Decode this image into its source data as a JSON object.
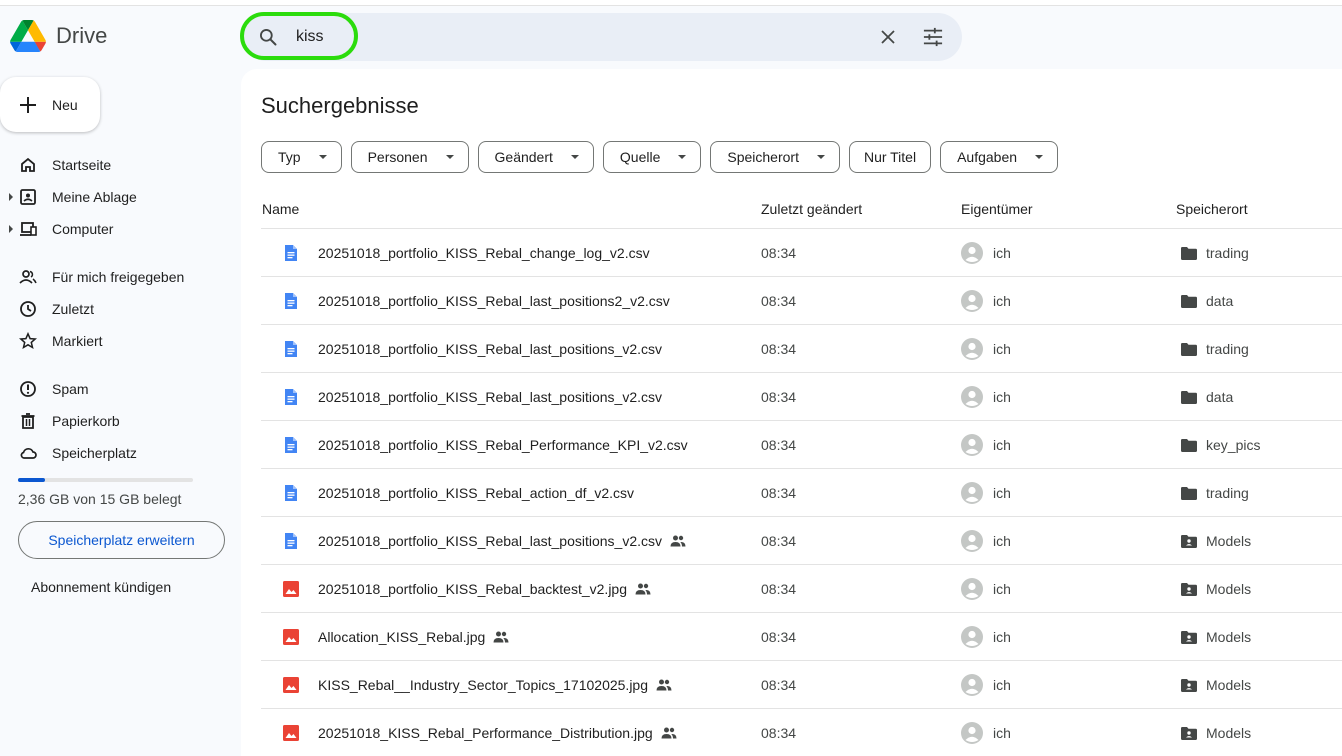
{
  "app": {
    "name": "Drive"
  },
  "search": {
    "value": "kiss"
  },
  "sidebar": {
    "new_label": "Neu",
    "items": [
      {
        "label": "Startseite",
        "icon": "home-icon"
      },
      {
        "label": "Meine Ablage",
        "icon": "my-drive-icon"
      },
      {
        "label": "Computer",
        "icon": "computer-icon"
      },
      {
        "label": "Für mich freigegeben",
        "icon": "shared-icon"
      },
      {
        "label": "Zuletzt",
        "icon": "clock-icon"
      },
      {
        "label": "Markiert",
        "icon": "star-icon"
      },
      {
        "label": "Spam",
        "icon": "spam-icon"
      },
      {
        "label": "Papierkorb",
        "icon": "trash-icon"
      },
      {
        "label": "Speicherplatz",
        "icon": "cloud-icon"
      }
    ],
    "storage_text": "2,36 GB von 15 GB belegt",
    "storage_fraction": 0.157,
    "upgrade_label": "Speicherplatz erweitern",
    "cancel_label": "Abonnement kündigen"
  },
  "main": {
    "title": "Suchergebnisse",
    "filters": [
      "Typ",
      "Personen",
      "Geändert",
      "Quelle",
      "Speicherort",
      "Nur Titel",
      "Aufgaben"
    ],
    "columns": {
      "name": "Name",
      "modified": "Zuletzt geändert",
      "owner": "Eigentümer",
      "location": "Speicherort"
    },
    "rows": [
      {
        "name": "20251018_portfolio_KISS_Rebal_change_log_v2.csv",
        "type": "doc",
        "shared": false,
        "modified": "08:34",
        "owner": "ich",
        "location": "trading",
        "loc_type": "folder"
      },
      {
        "name": "20251018_portfolio_KISS_Rebal_last_positions2_v2.csv",
        "type": "doc",
        "shared": false,
        "modified": "08:34",
        "owner": "ich",
        "location": "data",
        "loc_type": "folder"
      },
      {
        "name": "20251018_portfolio_KISS_Rebal_last_positions_v2.csv",
        "type": "doc",
        "shared": false,
        "modified": "08:34",
        "owner": "ich",
        "location": "trading",
        "loc_type": "folder"
      },
      {
        "name": "20251018_portfolio_KISS_Rebal_last_positions_v2.csv",
        "type": "doc",
        "shared": false,
        "modified": "08:34",
        "owner": "ich",
        "location": "data",
        "loc_type": "folder"
      },
      {
        "name": "20251018_portfolio_KISS_Rebal_Performance_KPI_v2.csv",
        "type": "doc",
        "shared": false,
        "modified": "08:34",
        "owner": "ich",
        "location": "key_pics",
        "loc_type": "folder"
      },
      {
        "name": "20251018_portfolio_KISS_Rebal_action_df_v2.csv",
        "type": "doc",
        "shared": false,
        "modified": "08:34",
        "owner": "ich",
        "location": "trading",
        "loc_type": "folder"
      },
      {
        "name": "20251018_portfolio_KISS_Rebal_last_positions_v2.csv",
        "type": "doc",
        "shared": true,
        "modified": "08:34",
        "owner": "ich",
        "location": "Models",
        "loc_type": "shared-folder"
      },
      {
        "name": "20251018_portfolio_KISS_Rebal_backtest_v2.jpg",
        "type": "image",
        "shared": true,
        "modified": "08:34",
        "owner": "ich",
        "location": "Models",
        "loc_type": "shared-folder"
      },
      {
        "name": "Allocation_KISS_Rebal.jpg",
        "type": "image",
        "shared": true,
        "modified": "08:34",
        "owner": "ich",
        "location": "Models",
        "loc_type": "shared-folder"
      },
      {
        "name": "KISS_Rebal__Industry_Sector_Topics_17102025.jpg",
        "type": "image",
        "shared": true,
        "modified": "08:34",
        "owner": "ich",
        "location": "Models",
        "loc_type": "shared-folder"
      },
      {
        "name": "20251018_KISS_Rebal_Performance_Distribution.jpg",
        "type": "image",
        "shared": true,
        "modified": "08:34",
        "owner": "ich",
        "location": "Models",
        "loc_type": "shared-folder"
      }
    ]
  },
  "colors": {
    "accent": "#0b57d0",
    "doc": "#4285f4",
    "image": "#ea4335",
    "highlight": "#2bdc0c"
  }
}
